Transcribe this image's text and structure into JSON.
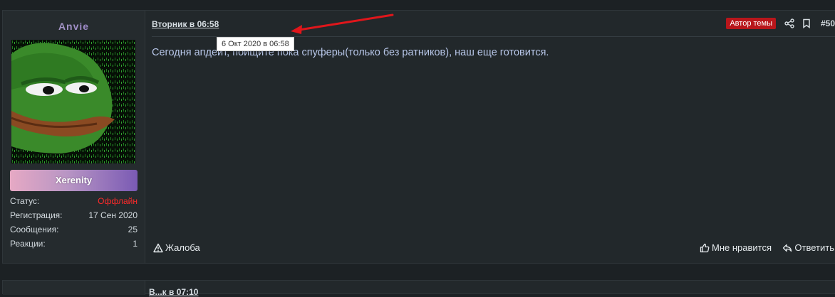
{
  "post": {
    "username": "Anvie",
    "banner": "Xerenity",
    "stats": [
      {
        "label": "Статус:",
        "value": "Оффлайн",
        "status": "offline"
      },
      {
        "label": "Регистрация:",
        "value": "17 Сен 2020"
      },
      {
        "label": "Сообщения:",
        "value": "25"
      },
      {
        "label": "Реакции:",
        "value": "1"
      }
    ],
    "date": "Вторник в 06:58",
    "tooltip": "6 Окт 2020 в 06:58",
    "author_badge": "Автор темы",
    "number": "#50",
    "message": "Сегодня апдейт, поищите пока спуферы(только без ратников), наш еще готовится.",
    "actions": {
      "report": "Жалоба",
      "like": "Мне нравится",
      "reply": "Ответить"
    },
    "icons": [
      "share-icon",
      "bookmark-icon",
      "warning-icon",
      "thumbs-up-icon",
      "reply-icon"
    ]
  },
  "next_post": {
    "date": "В...к в 07:10"
  },
  "colors": {
    "background": "#1c2124",
    "panel": "#22282b",
    "offline": "#ff2a2a",
    "badge": "#b8161b",
    "annotation_arrow": "#e0161b"
  }
}
